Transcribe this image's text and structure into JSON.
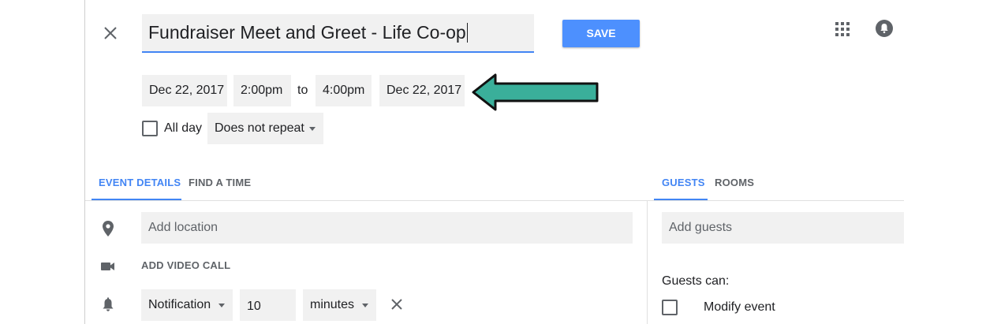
{
  "event": {
    "title": "Fundraiser Meet and Greet - Life Co-op"
  },
  "toolbar": {
    "save_label": "SAVE",
    "close_icon": "close-icon",
    "apps_icon": "apps-grid-icon",
    "notifications_icon": "notifications-icon"
  },
  "datetime": {
    "start_date": "Dec 22, 2017",
    "start_time": "2:00pm",
    "separator": "to",
    "end_time": "4:00pm",
    "end_date": "Dec 22, 2017",
    "all_day_label": "All day",
    "all_day_checked": false,
    "repeat_value": "Does not repeat"
  },
  "annotation": {
    "arrow_color": "#3aaf9a",
    "arrow_outline": "#111111"
  },
  "tabs_left": [
    {
      "label": "EVENT DETAILS",
      "active": true
    },
    {
      "label": "FIND A TIME",
      "active": false
    }
  ],
  "tabs_right": [
    {
      "label": "GUESTS",
      "active": true
    },
    {
      "label": "ROOMS",
      "active": false
    }
  ],
  "details": {
    "location_placeholder": "Add location",
    "video_call_label": "ADD VIDEO CALL",
    "notification": {
      "type": "Notification",
      "value": "10",
      "unit": "minutes"
    }
  },
  "guests": {
    "input_placeholder": "Add guests",
    "permissions_heading": "Guests can:",
    "permissions": [
      {
        "label": "Modify event",
        "checked": false
      }
    ]
  },
  "colors": {
    "accent": "#4285f4",
    "save_button": "#4d90fe",
    "field_background": "#f1f1f1"
  }
}
